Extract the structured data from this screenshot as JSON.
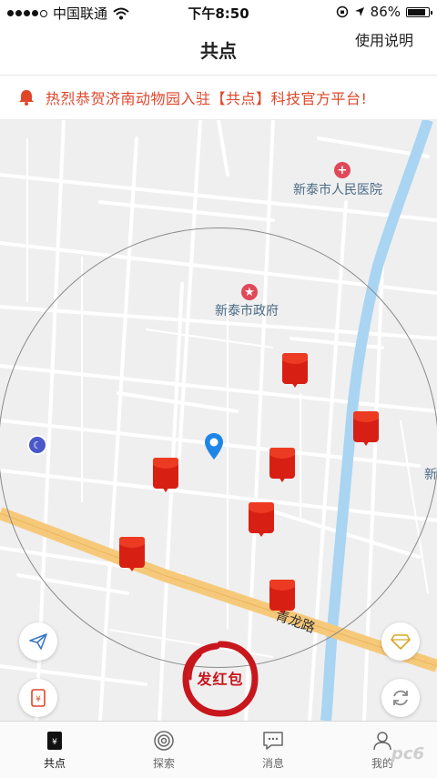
{
  "status_bar": {
    "carrier": "中国联通",
    "time": "下午8:50",
    "battery": "86%",
    "battery_level": 0.86
  },
  "navbar": {
    "title": "共点",
    "help_label": "使用说明"
  },
  "announcement": {
    "text": "热烈恭贺济南动物园入驻【共点】科技官方平台!",
    "color": "#e0462a"
  },
  "map": {
    "pois": [
      {
        "label": "新泰市人民医院",
        "icon": "hospital-icon"
      },
      {
        "label": "新泰市政府",
        "icon": "government-icon"
      },
      {
        "label": "新"
      }
    ],
    "road_label": "青龙路",
    "red_packet_count": 8,
    "send_button_label": "发红包"
  },
  "colors": {
    "accent_red": "#d81f14",
    "river_blue": "#a9d4f2",
    "main_road": "#f6c97a",
    "location_blue": "#1f86e8"
  },
  "tabbar": {
    "tabs": [
      {
        "label": "共点",
        "icon": "red-envelope-icon",
        "active": true
      },
      {
        "label": "探索",
        "icon": "explore-icon",
        "active": false
      },
      {
        "label": "消息",
        "icon": "message-icon",
        "active": false
      },
      {
        "label": "我的",
        "icon": "profile-icon",
        "active": false
      }
    ]
  },
  "watermark": "pc6"
}
